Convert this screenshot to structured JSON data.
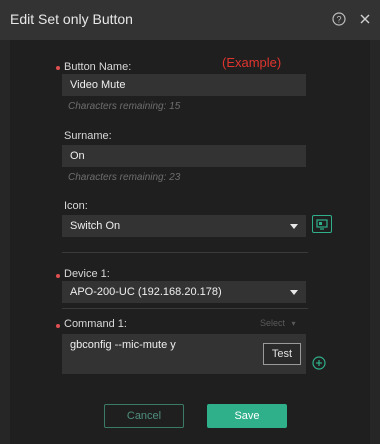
{
  "dialog": {
    "title": "Edit Set only Button"
  },
  "example_label": "(Example)",
  "button_name": {
    "label": "Button Name:",
    "value": "Video Mute",
    "hint": "Characters remaining: 15"
  },
  "surname": {
    "label": "Surname:",
    "value": "On",
    "hint": "Characters remaining: 23"
  },
  "icon": {
    "label": "Icon:",
    "value": "Switch On"
  },
  "device1": {
    "label": "Device 1:",
    "value": "APO-200-UC (192.168.20.178)"
  },
  "command1": {
    "label": "Command 1:",
    "select_label": "Select",
    "value": "gbconfig --mic-mute y",
    "test_label": "Test"
  },
  "footer": {
    "cancel_label": "Cancel",
    "save_label": "Save"
  },
  "colors": {
    "accent": "#2fb08a",
    "required": "#e05050",
    "example": "#e0342e"
  },
  "icons": {
    "help": "help-circle-icon",
    "close": "close-icon",
    "preview": "monitor-preview-icon",
    "add": "plus-circle-icon"
  }
}
